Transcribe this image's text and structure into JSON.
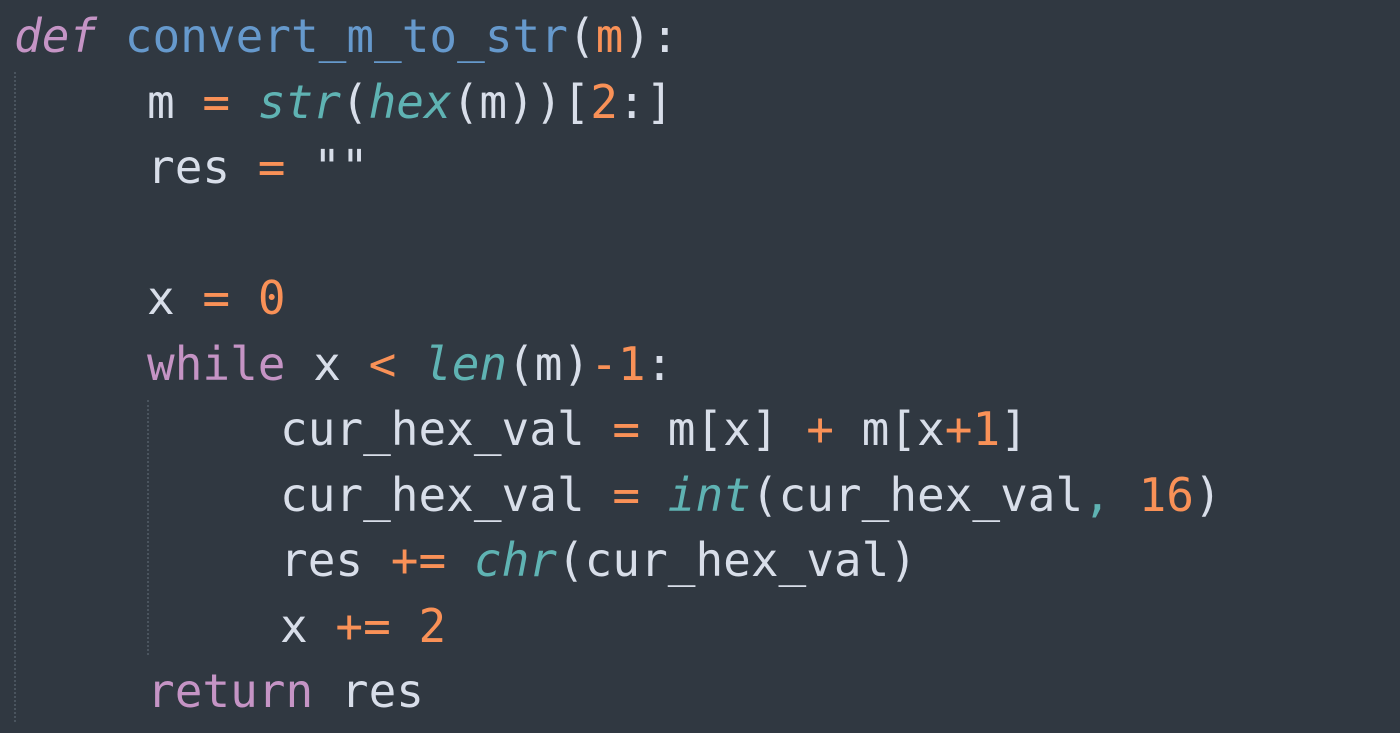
{
  "code": {
    "line1": {
      "def": "def",
      "name": "convert_m_to_str",
      "open": "(",
      "param": "m",
      "close": "):"
    },
    "line2": {
      "var": "m",
      "eq": "=",
      "str_fn": "str",
      "open1": "(",
      "hex_fn": "hex",
      "open2": "(m))[",
      "num": "2",
      "rest": ":]"
    },
    "line3": {
      "var": "res",
      "eq": "=",
      "value": "\"\""
    },
    "line5": {
      "var": "x",
      "eq": "=",
      "num": "0"
    },
    "line6": {
      "kw": "while",
      "var": "x",
      "lt": "<",
      "len_fn": "len",
      "args": "(m)",
      "minus": "-",
      "num": "1",
      "colon": ":"
    },
    "line7": {
      "var": "cur_hex_val",
      "eq": "=",
      "a": "m[x]",
      "plus": "+",
      "b": "m[x",
      "plus2": "+",
      "num": "1",
      "close": "]"
    },
    "line8": {
      "var": "cur_hex_val",
      "eq": "=",
      "int_fn": "int",
      "open": "(cur_hex_val",
      "comma": ",",
      "num": "16",
      "close": ")"
    },
    "line9": {
      "var": "res",
      "op": "+=",
      "chr_fn": "chr",
      "args": "(cur_hex_val)"
    },
    "line10": {
      "var": "x",
      "op": "+=",
      "num": "2"
    },
    "line11": {
      "kw": "return",
      "var": "res"
    }
  },
  "colors": {
    "background": "#303841",
    "text": "#d8dee9",
    "keyword": "#c594c5",
    "function_name": "#6699cc",
    "builtin": "#5fb3b3",
    "operator": "#f99157",
    "number": "#f99157"
  }
}
